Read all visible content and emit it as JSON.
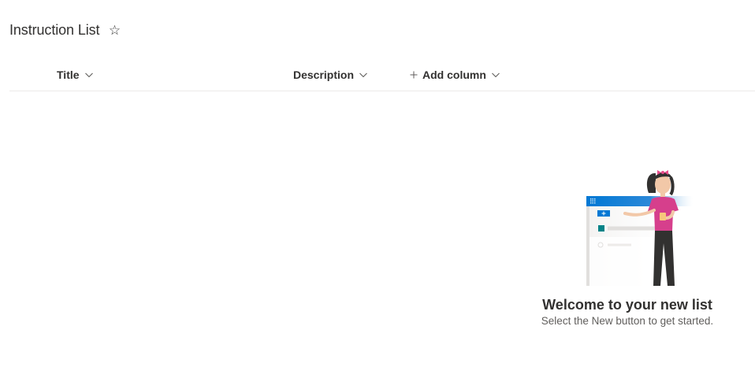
{
  "list": {
    "title": "Instruction List",
    "favorite_icon": "star-outline-icon"
  },
  "columns": [
    {
      "label": "Title",
      "icon": "chevron-down-icon"
    },
    {
      "label": "Description",
      "icon": "chevron-down-icon"
    },
    {
      "label": "Add column",
      "icon": "plus-icon"
    }
  ],
  "empty_state": {
    "heading": "Welcome to your new list",
    "subtext": "Select the New button to get started.",
    "illustration": "person-presenting-list-illustration"
  },
  "colors": {
    "accent": "#0078d4",
    "shirt": "#d63f8c",
    "teal": "#038387",
    "text": "#323130",
    "subtext": "#605e5c"
  }
}
